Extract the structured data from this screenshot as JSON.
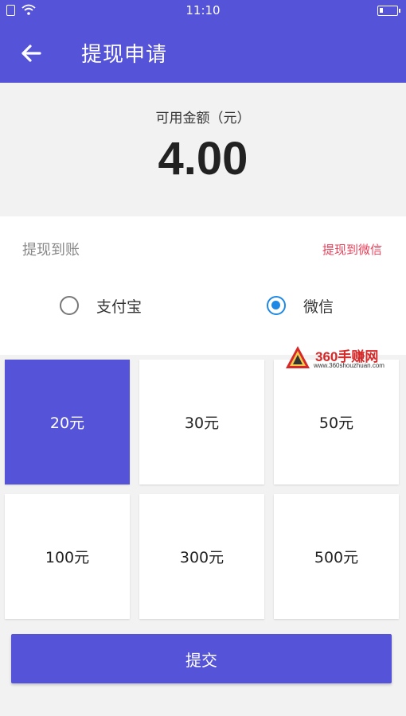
{
  "status_bar": {
    "time": "11:10",
    "icons": [
      "sim-icon",
      "wifi-icon",
      "battery-icon"
    ]
  },
  "app_bar": {
    "back_icon": "arrow-left-icon",
    "title": "提现申请"
  },
  "balance": {
    "label": "可用金额（元）",
    "amount": "4.00"
  },
  "payout": {
    "label": "提现到账",
    "destination": "提现到微信",
    "options": [
      {
        "label": "支付宝",
        "selected": false
      },
      {
        "label": "微信",
        "selected": true
      }
    ]
  },
  "amounts": [
    {
      "label": "20元",
      "selected": true
    },
    {
      "label": "30元",
      "selected": false
    },
    {
      "label": "50元",
      "selected": false
    },
    {
      "label": "100元",
      "selected": false
    },
    {
      "label": "300元",
      "selected": false
    },
    {
      "label": "500元",
      "selected": false
    }
  ],
  "watermark": {
    "brand": "360手赚网",
    "url": "www.360shouzhuan.com"
  },
  "submit_label": "提交",
  "colors": {
    "primary": "#5553d8",
    "accent_red": "#e8415a",
    "radio_blue": "#1e88e5",
    "background": "#f2f2f2"
  }
}
